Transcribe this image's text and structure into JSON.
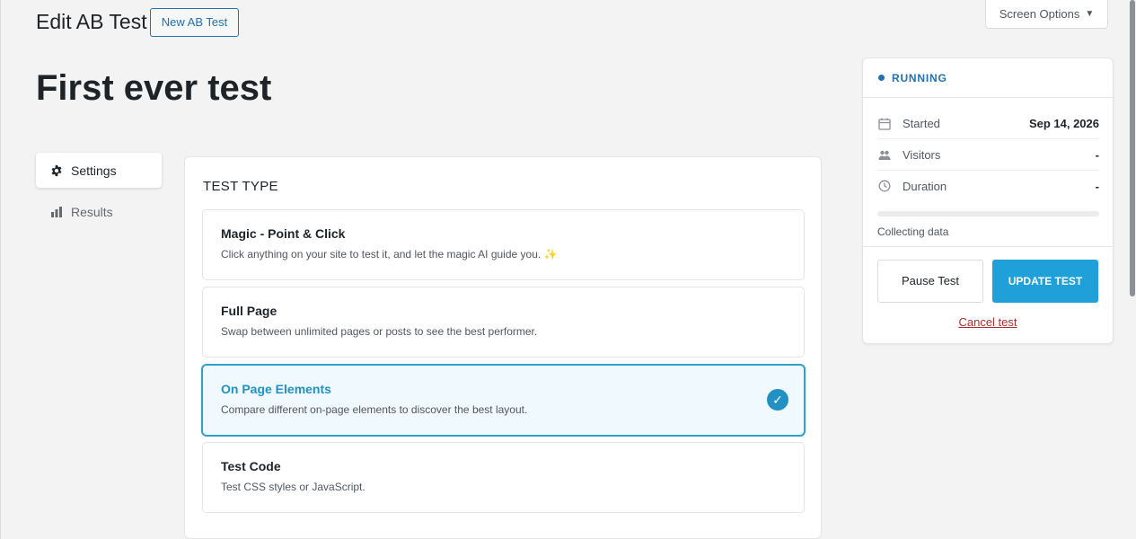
{
  "header": {
    "title": "Edit AB Test",
    "new_button": "New AB Test",
    "screen_options": "Screen Options"
  },
  "test": {
    "name": "First ever test"
  },
  "nav": {
    "items": [
      {
        "label": "Settings",
        "icon": "gear-icon",
        "active": true
      },
      {
        "label": "Results",
        "icon": "bar-chart-icon",
        "active": false
      }
    ]
  },
  "test_type": {
    "title": "TEST TYPE",
    "options": [
      {
        "title": "Magic - Point & Click",
        "desc": "Click anything on your site to test it, and let the magic AI guide you. ✨",
        "selected": false
      },
      {
        "title": "Full Page",
        "desc": "Swap between unlimited pages or posts to see the best performer.",
        "selected": false
      },
      {
        "title": "On Page Elements",
        "desc": "Compare different on-page elements to discover the best layout.",
        "selected": true
      },
      {
        "title": "Test Code",
        "desc": "Test CSS styles or JavaScript.",
        "selected": false
      }
    ]
  },
  "status": {
    "state": "RUNNING",
    "stats": [
      {
        "label": "Started",
        "value": "Sep 14, 2026",
        "icon": "calendar-icon"
      },
      {
        "label": "Visitors",
        "value": "-",
        "icon": "users-icon"
      },
      {
        "label": "Duration",
        "value": "-",
        "icon": "clock-icon"
      }
    ],
    "progress_fraction": 0,
    "collecting": "Collecting data",
    "pause": "Pause Test",
    "update": "UPDATE TEST",
    "cancel": "Cancel test"
  },
  "colors": {
    "accent": "#2191c4",
    "primary_button": "#1fa0d8",
    "link_blue": "#2271b1",
    "danger": "#b32d2e"
  }
}
